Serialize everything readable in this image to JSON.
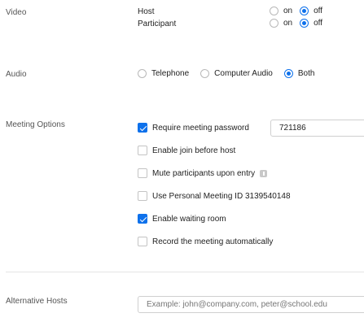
{
  "video": {
    "label": "Video",
    "host": {
      "label": "Host",
      "on_label": "on",
      "off_label": "off",
      "selected": "off"
    },
    "participant": {
      "label": "Participant",
      "on_label": "on",
      "off_label": "off",
      "selected": "off"
    }
  },
  "audio": {
    "label": "Audio",
    "options": [
      "Telephone",
      "Computer Audio",
      "Both"
    ],
    "selected": "Both"
  },
  "meeting_options": {
    "label": "Meeting Options",
    "require_password": {
      "label": "Require meeting password",
      "checked": true,
      "value": "721186"
    },
    "join_before_host": {
      "label": "Enable join before host",
      "checked": false
    },
    "mute_on_entry": {
      "label": "Mute participants upon entry",
      "checked": false
    },
    "personal_meeting_id": {
      "label": "Use Personal Meeting ID 3139540148",
      "checked": false
    },
    "waiting_room": {
      "label": "Enable waiting room",
      "checked": true
    },
    "record_auto": {
      "label": "Record the meeting automatically",
      "checked": false
    }
  },
  "alternative_hosts": {
    "label": "Alternative Hosts",
    "value": "",
    "placeholder": "Example: john@company.com, peter@school.edu"
  },
  "colors": {
    "accent": "#0e71eb"
  }
}
